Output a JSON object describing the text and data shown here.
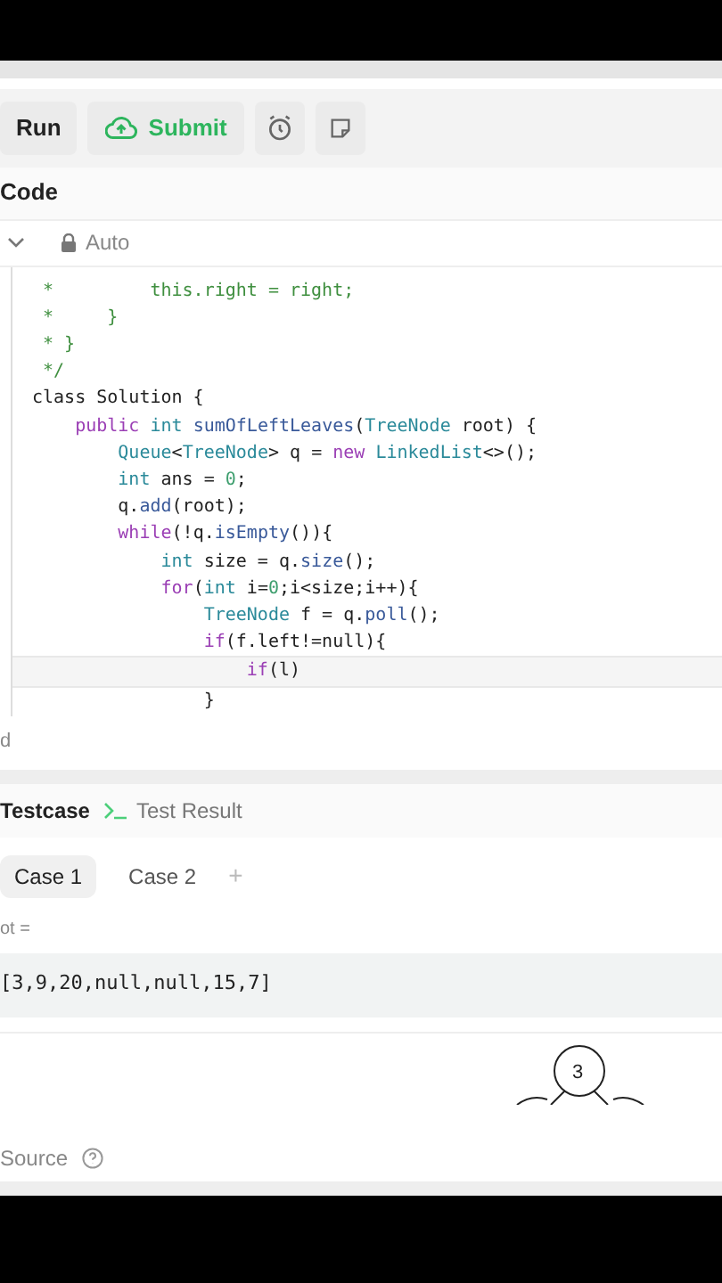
{
  "toolbar": {
    "run": "Run",
    "submit": "Submit"
  },
  "editor": {
    "title": "Code",
    "language": "Auto",
    "lines": [
      {
        "current": false,
        "tokens": [
          {
            "kind": "comment",
            "text": " *         this.right = right;"
          }
        ]
      },
      {
        "current": false,
        "tokens": [
          {
            "kind": "comment",
            "text": " *     }"
          }
        ]
      },
      {
        "current": false,
        "tokens": [
          {
            "kind": "comment",
            "text": " * }"
          }
        ]
      },
      {
        "current": false,
        "tokens": [
          {
            "kind": "comment",
            "text": " */"
          }
        ]
      },
      {
        "current": false,
        "tokens": [
          {
            "kind": "plain",
            "text": "class Solution {"
          }
        ]
      },
      {
        "current": false,
        "tokens": [
          {
            "kind": "keyword",
            "text": "    public"
          },
          {
            "kind": "type",
            "text": " int"
          },
          {
            "kind": "method",
            "text": " sumOfLeftLeaves"
          },
          {
            "kind": "plain",
            "text": "("
          },
          {
            "kind": "type",
            "text": "TreeNode"
          },
          {
            "kind": "plain",
            "text": " root) {"
          }
        ]
      },
      {
        "current": false,
        "tokens": [
          {
            "kind": "type",
            "text": "        Queue"
          },
          {
            "kind": "plain",
            "text": "<"
          },
          {
            "kind": "type",
            "text": "TreeNode"
          },
          {
            "kind": "plain",
            "text": "> q = "
          },
          {
            "kind": "keyword",
            "text": "new"
          },
          {
            "kind": "type",
            "text": " LinkedList"
          },
          {
            "kind": "plain",
            "text": "<>();"
          }
        ]
      },
      {
        "current": false,
        "tokens": [
          {
            "kind": "type",
            "text": "        int"
          },
          {
            "kind": "plain",
            "text": " ans = "
          },
          {
            "kind": "number",
            "text": "0"
          },
          {
            "kind": "plain",
            "text": ";"
          }
        ]
      },
      {
        "current": false,
        "tokens": [
          {
            "kind": "plain",
            "text": "        q."
          },
          {
            "kind": "method",
            "text": "add"
          },
          {
            "kind": "plain",
            "text": "(root);"
          }
        ]
      },
      {
        "current": false,
        "tokens": [
          {
            "kind": "keyword",
            "text": "        while"
          },
          {
            "kind": "plain",
            "text": "(!q."
          },
          {
            "kind": "method",
            "text": "isEmpty"
          },
          {
            "kind": "plain",
            "text": "()){"
          }
        ]
      },
      {
        "current": false,
        "tokens": [
          {
            "kind": "type",
            "text": "            int"
          },
          {
            "kind": "plain",
            "text": " size = q."
          },
          {
            "kind": "method",
            "text": "size"
          },
          {
            "kind": "plain",
            "text": "();"
          }
        ]
      },
      {
        "current": false,
        "tokens": [
          {
            "kind": "keyword",
            "text": "            for"
          },
          {
            "kind": "plain",
            "text": "("
          },
          {
            "kind": "type",
            "text": "int"
          },
          {
            "kind": "plain",
            "text": " i="
          },
          {
            "kind": "number",
            "text": "0"
          },
          {
            "kind": "plain",
            "text": ";i<size;i++){"
          }
        ]
      },
      {
        "current": false,
        "tokens": [
          {
            "kind": "type",
            "text": "                TreeNode"
          },
          {
            "kind": "plain",
            "text": " f = q."
          },
          {
            "kind": "method",
            "text": "poll"
          },
          {
            "kind": "plain",
            "text": "();"
          }
        ]
      },
      {
        "current": false,
        "tokens": [
          {
            "kind": "keyword",
            "text": "                if"
          },
          {
            "kind": "plain",
            "text": "(f.left!=null){"
          }
        ]
      },
      {
        "current": true,
        "tokens": [
          {
            "kind": "keyword",
            "text": "                    if"
          },
          {
            "kind": "plain",
            "text": "(l)"
          }
        ]
      },
      {
        "current": false,
        "tokens": [
          {
            "kind": "plain",
            "text": "                }"
          }
        ]
      }
    ],
    "status": "d"
  },
  "console": {
    "tabs": [
      {
        "label": "Testcase",
        "selected": true
      },
      {
        "label": "Test Result",
        "selected": false
      }
    ],
    "cases": [
      {
        "label": "Case 1",
        "selected": true
      },
      {
        "label": "Case 2",
        "selected": false
      }
    ],
    "add": "+",
    "param_label": "ot =",
    "param_value": "[3,9,20,null,null,15,7]",
    "tree_root": "3",
    "source": "Source"
  }
}
